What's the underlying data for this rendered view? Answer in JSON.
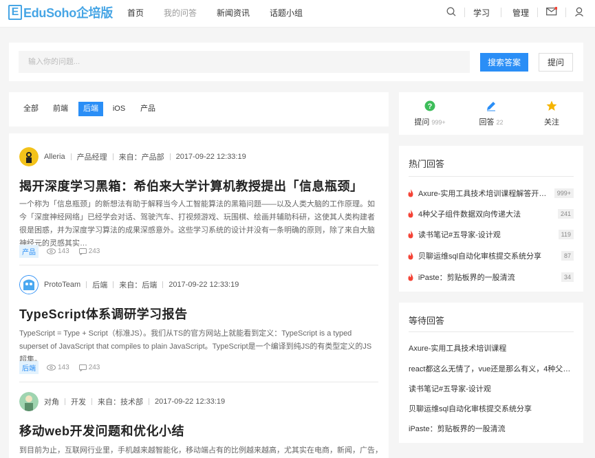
{
  "brand": {
    "mark": "E",
    "name": "EduSoho企培版"
  },
  "nav": {
    "items": [
      "首页",
      "我的问答",
      "新闻资讯",
      "话题小组"
    ]
  },
  "header_right": {
    "study": "学习",
    "manage": "管理"
  },
  "search": {
    "placeholder": "输入你的问题...",
    "search_button": "搜索答案",
    "ask_button": "提问"
  },
  "tabs": [
    "全部",
    "前端",
    "后端",
    "iOS",
    "产品"
  ],
  "active_tab": "后端",
  "articles": [
    {
      "author": "Alleria",
      "role": "产品经理",
      "from": "来自：产品部",
      "time": "2017-09-22  12:33:19",
      "title": "揭开深度学习黑箱：希伯来大学计算机教授提出「信息瓶颈」",
      "body": "一个称为「信息瓶颈」的新想法有助于解释当今人工智能算法的黑箱问题——以及人类大脑的工作原理。如今「深度神经网络」已经学会对话、驾驶汽车、打视频游戏、玩围棋、绘画并辅助科研，这使其人类构建者很是困惑，并为深度学习算法的成果深感意外。这些学习系统的设计并没有一条明确的原则，除了来自大脑神经元的灵感其实…",
      "tag": "产品",
      "views": "143",
      "comments": "243"
    },
    {
      "author": "ProtoTeam",
      "role": "后端",
      "from": "来自：后端",
      "time": "2017-09-22  12:33:19",
      "title": "TypeScript体系调研学习报告",
      "body": "TypeScript = Type + Script（标准JS）。我们从TS的官方网站上就能看到定义：TypeScript is a typed superset of JavaScript that compiles to plain JavaScript。TypeScript是一个编译到纯JS的有类型定义的JS超集。",
      "tag": "后端",
      "views": "143",
      "comments": "243"
    },
    {
      "author": "对角",
      "role": "开发",
      "from": "来自：技术部",
      "time": "2017-09-22  12:33:19",
      "title": "移动web开发问题和优化小结",
      "body": "到目前为止，互联网行业里，手机越来越智能化，移动端占有的比例越来越高，尤其实在电商，新闻，广告，游戏"
    }
  ],
  "side_stats": [
    {
      "label": "提问",
      "count": "999+"
    },
    {
      "label": "回答",
      "count": "22"
    },
    {
      "label": "关注",
      "count": ""
    }
  ],
  "hot_answers": {
    "title": "热门回答",
    "items": [
      {
        "text": "Axure-实用工具技术培训课程解答开课…",
        "count": "999+"
      },
      {
        "text": "4种父子组件数据双向传递大法",
        "count": "241"
      },
      {
        "text": "读书笔记#五导家-设计观",
        "count": "119"
      },
      {
        "text": "贝聊运维sql自动化审核提交系统分享",
        "count": "87"
      },
      {
        "text": "iPaste：剪贴板界的一股清流",
        "count": "34"
      }
    ]
  },
  "waiting": {
    "title": "等待回答",
    "items": [
      "Axure-实用工具技术培训课程",
      "react都这么无情了，vue还是那么有义，4种父子组…",
      "读书笔记#五导家-设计观",
      "贝聊运维sql自动化审核提交系统分享",
      "iPaste：剪贴板界的一股清流"
    ]
  },
  "colors": {
    "accent": "#2a8ef6",
    "brand": "#46a5e5",
    "hot": "#f44336",
    "ask_icon": "#3dbd5a",
    "answer_icon": "#2a8ef6",
    "follow_icon": "#f5b400"
  }
}
